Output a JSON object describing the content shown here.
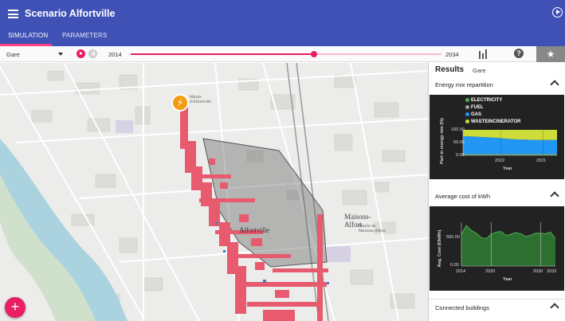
{
  "header": {
    "title": "Scenario Alfortville",
    "tabs": [
      "SIMULATION",
      "PARAMETERS"
    ]
  },
  "toolbar": {
    "select_value": "Gare",
    "start_year": "2014",
    "end_year": "2034",
    "slider_progress": 0.59,
    "star_glyph": "★",
    "help_glyph": "?"
  },
  "map": {
    "labels": {
      "alfortville": "Alfortville",
      "maisons_alfort": "Maisons-\nAlfort",
      "mairie_alfortville": "Mairie\nd'Alfortville",
      "mairie_maisons": "Mairie de\nMaisons-Alfort"
    },
    "fab_glyph": "+",
    "bolt_glyph": "⚡"
  },
  "panel": {
    "title": "Results",
    "subtitle": "Gare",
    "sections": {
      "energy_mix": "Energy mix repartition",
      "avg_cost": "Average cost of kWh",
      "connected": "Connected buildings"
    }
  },
  "chart_data": [
    {
      "type": "area",
      "stacked": true,
      "ylabel": "Part in energy mix (%)",
      "xlabel": "Year",
      "ylim": [
        0,
        100
      ],
      "y_ticks": [
        "100.00",
        "50.00",
        "0.00"
      ],
      "x_ticks": [
        "2022",
        "2031"
      ],
      "x": [
        2014,
        2015,
        2016,
        2017,
        2018,
        2019,
        2020,
        2021,
        2022,
        2023,
        2024,
        2025,
        2026,
        2027,
        2028,
        2029,
        2030,
        2031,
        2032,
        2033,
        2034
      ],
      "series": [
        {
          "name": "ELECTRICITY",
          "color": "#4caf50",
          "values": [
            3,
            3,
            3,
            3,
            3,
            3,
            3,
            3,
            3,
            3,
            3,
            3,
            3,
            3,
            3,
            3,
            3,
            3,
            3,
            3,
            3
          ]
        },
        {
          "name": "FUEL",
          "color": "#9e9e9e",
          "values": [
            2,
            2,
            2,
            2,
            2,
            2,
            2,
            2,
            2,
            2,
            2,
            2,
            2,
            2,
            2,
            2,
            2,
            2,
            2,
            2,
            2
          ]
        },
        {
          "name": "GAS",
          "color": "#2196f3",
          "values": [
            70,
            70,
            69,
            68,
            67,
            66,
            65,
            64,
            62,
            61,
            59,
            58,
            57,
            57,
            56,
            56,
            55,
            55,
            55,
            55,
            55
          ]
        },
        {
          "name": "WASTEINCINERATOR",
          "color": "#cddc39",
          "values": [
            25,
            25,
            26,
            27,
            28,
            29,
            30,
            31,
            33,
            34,
            36,
            37,
            38,
            38,
            39,
            39,
            40,
            40,
            40,
            40,
            40
          ]
        }
      ]
    },
    {
      "type": "area",
      "ylabel": "Avg. Cost (€/kWh)",
      "xlabel": "Year",
      "ylim": [
        0,
        800
      ],
      "y_ticks": [
        "500.00",
        "0.00"
      ],
      "x_ticks": [
        "2014",
        "2020",
        "2030",
        "2033"
      ],
      "x": [
        2014,
        2015,
        2016,
        2017,
        2018,
        2019,
        2020,
        2021,
        2022,
        2023,
        2024,
        2025,
        2026,
        2027,
        2028,
        2029,
        2030,
        2031,
        2032,
        2033
      ],
      "series": [
        {
          "name": "",
          "color": "#4caf50",
          "values": [
            580,
            740,
            650,
            600,
            520,
            500,
            580,
            620,
            630,
            560,
            580,
            610,
            590,
            540,
            560,
            600,
            600,
            590,
            620,
            500
          ]
        }
      ]
    }
  ]
}
